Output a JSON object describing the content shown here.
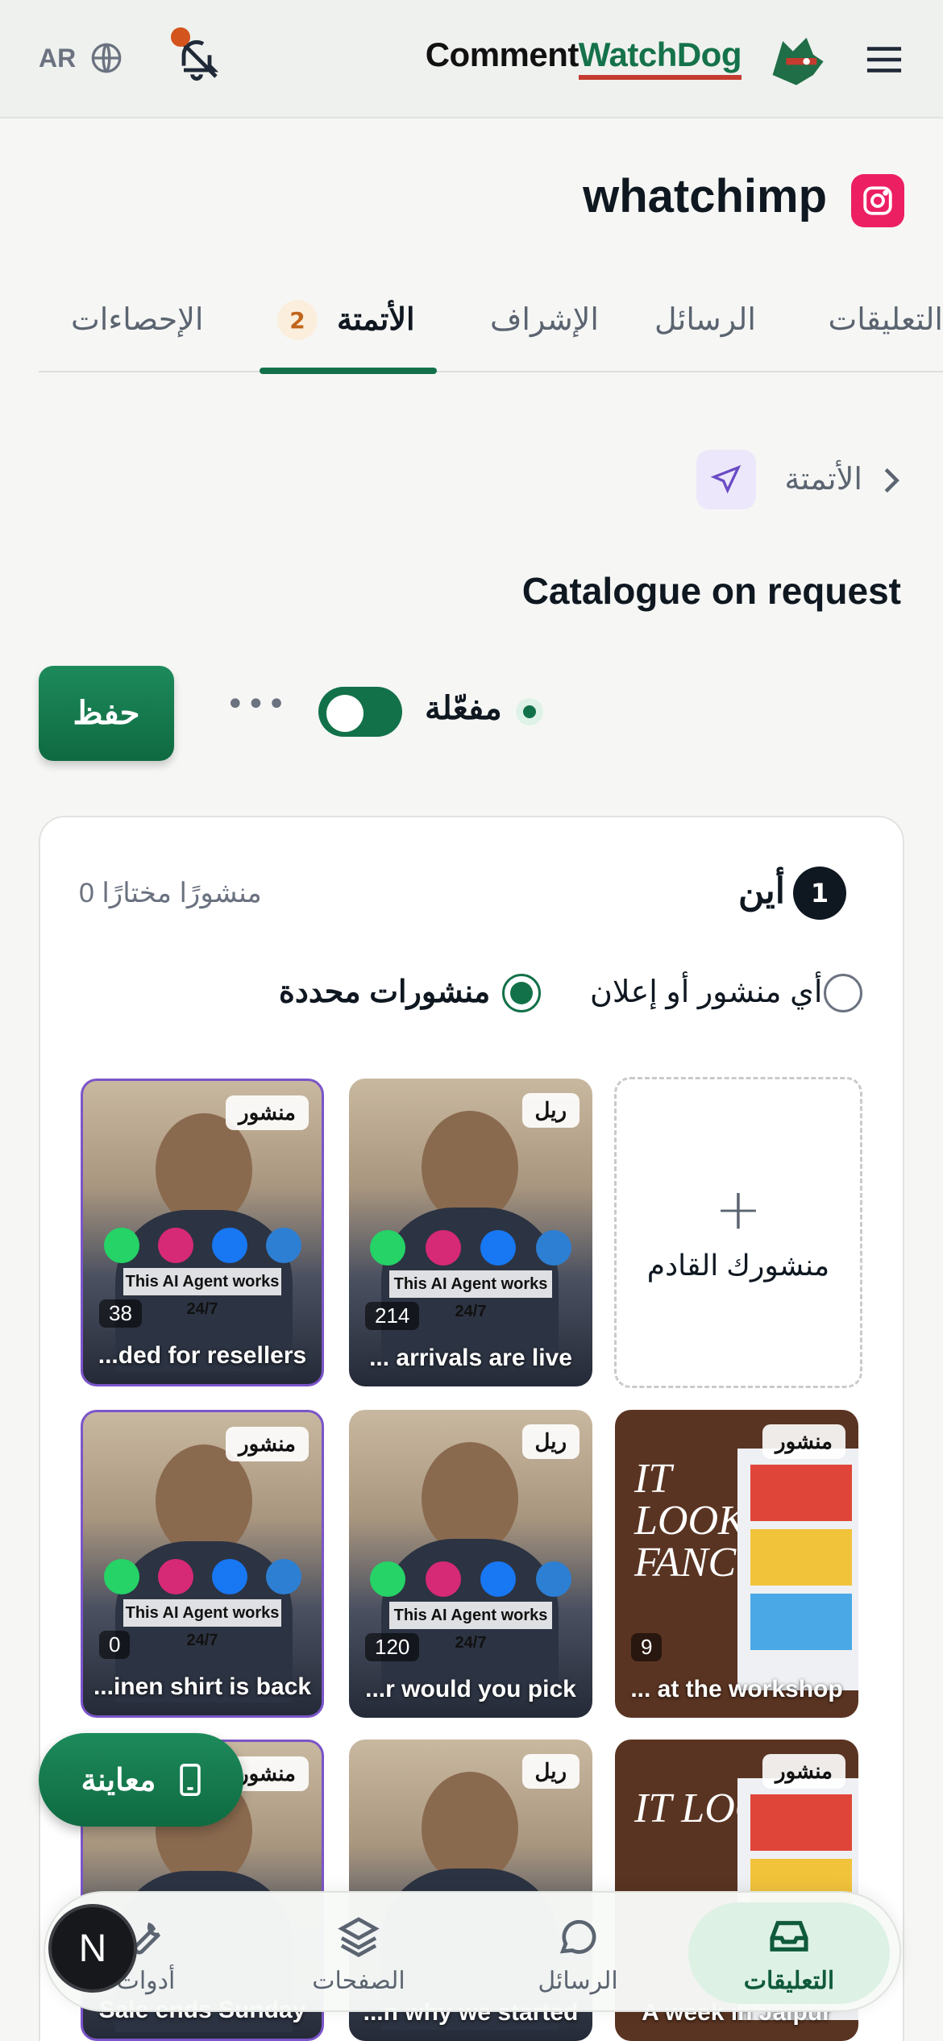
{
  "header": {
    "language": "AR",
    "brand_part1": "Comment",
    "brand_part2": "WatchDog"
  },
  "page": {
    "title": "whatchimp"
  },
  "tabs": [
    {
      "label": "التعليقات"
    },
    {
      "label": "الرسائل"
    },
    {
      "label": "الإشراف"
    },
    {
      "label": "الأتمتة",
      "active": true,
      "badge": "2"
    },
    {
      "label": "الإحصاءات"
    }
  ],
  "breadcrumb": {
    "label": "الأتمتة"
  },
  "automation": {
    "name": "Catalogue on request",
    "status": "مفعّلة",
    "save_label": "حفظ",
    "more_label": "•••",
    "enabled": true
  },
  "where": {
    "step": "1",
    "title": "أين",
    "selected_count": "0 منشورًا مختارًا",
    "option_any": "أي منشور أو إعلان",
    "option_specific": "منشورات محددة",
    "selected_option": "specific"
  },
  "add_post": {
    "plus": "+",
    "label": "منشورك القادم"
  },
  "posts": [
    {
      "type": "ريل",
      "caption": "... arrivals are live",
      "count": "214",
      "banner": "This AI Agent works 24/7"
    },
    {
      "type": "منشور",
      "caption": "...ded for resellers",
      "count": "38",
      "banner": "This AI Agent works 24/7"
    },
    {
      "type": "منشور",
      "caption": "... at the workshop",
      "count": "9",
      "banner": "It looks fancy"
    },
    {
      "type": "ريل",
      "caption": "...r would you pick",
      "count": "120",
      "banner": "This AI Agent works 24/7"
    },
    {
      "type": "منشور",
      "caption": "...inen shirt is back",
      "count": "0",
      "banner": "This AI Agent works 24/7"
    },
    {
      "type": "منشور",
      "caption": "A week in Jaipur",
      "banner": "IT LOOKS"
    },
    {
      "type": "ريل",
      "caption": "...n why we started"
    },
    {
      "type": "منشور",
      "caption": "Sale ends Sunday"
    }
  ],
  "preview": {
    "label": "معاينة"
  },
  "bottom_nav": [
    {
      "label": "التعليقات",
      "icon": "inbox-icon",
      "active": true
    },
    {
      "label": "الرسائل",
      "icon": "chat-bubble-icon"
    },
    {
      "label": "الصفحات",
      "icon": "layers-icon"
    },
    {
      "label": "أدوات",
      "icon": "wrench-icon"
    }
  ],
  "user": {
    "avatar_initial": "N"
  },
  "colors": {
    "primary_green": "#137149",
    "brand_red": "#c63b2f",
    "instagram_pink": "#ec1f63",
    "badge_orange": "#c0651a",
    "selection_purple": "#7b55c9"
  }
}
